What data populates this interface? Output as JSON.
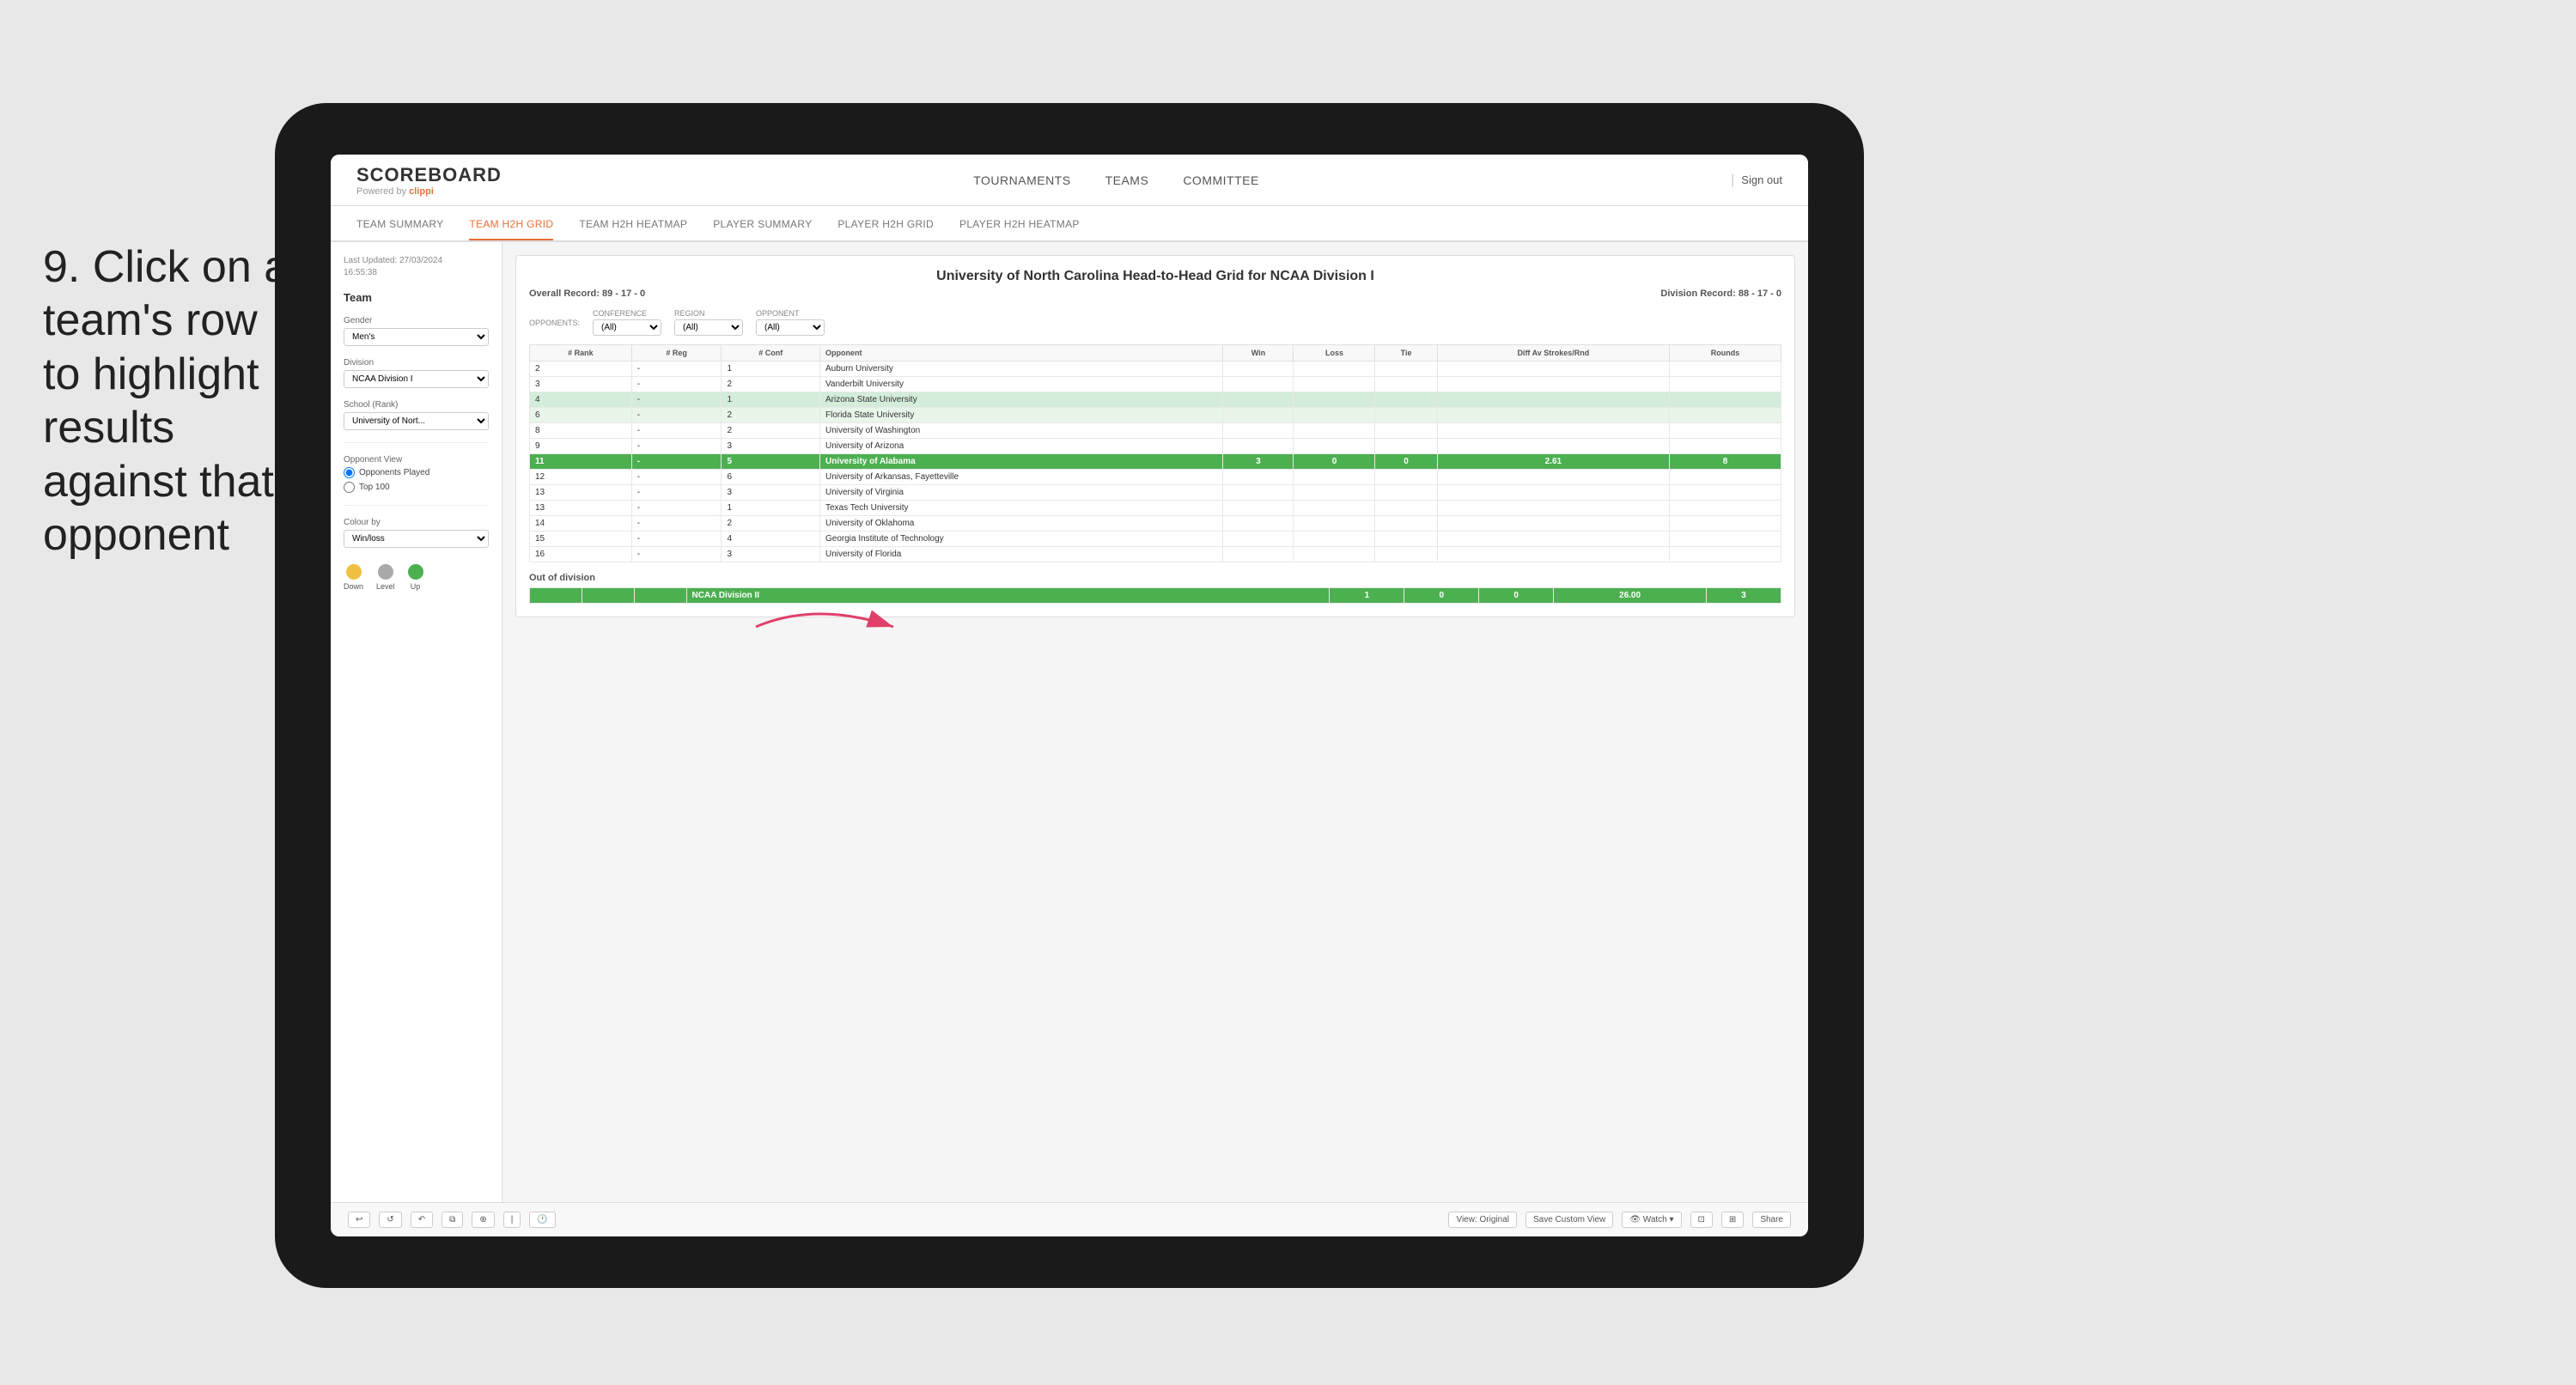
{
  "instruction": {
    "step": "9.",
    "text": "Click on a team's row to highlight results against that opponent"
  },
  "nav": {
    "logo": "SCOREBOARD",
    "powered_by": "Powered by",
    "brand": "clippi",
    "links": [
      "TOURNAMENTS",
      "TEAMS",
      "COMMITTEE"
    ],
    "sign_out": "Sign out"
  },
  "sub_tabs": [
    {
      "label": "TEAM SUMMARY",
      "active": false
    },
    {
      "label": "TEAM H2H GRID",
      "active": true
    },
    {
      "label": "TEAM H2H HEATMAP",
      "active": false
    },
    {
      "label": "PLAYER SUMMARY",
      "active": false
    },
    {
      "label": "PLAYER H2H GRID",
      "active": false
    },
    {
      "label": "PLAYER H2H HEATMAP",
      "active": false
    }
  ],
  "sidebar": {
    "meta_label": "Last Updated: 27/03/2024",
    "meta_time": "16:55:38",
    "team_label": "Team",
    "gender_label": "Gender",
    "gender_value": "Men's",
    "division_label": "Division",
    "division_value": "NCAA Division I",
    "school_label": "School (Rank)",
    "school_value": "University of Nort...",
    "opponent_view_label": "Opponent View",
    "radio_opponents": "Opponents Played",
    "radio_top100": "Top 100",
    "colour_by_label": "Colour by",
    "colour_by_value": "Win/loss",
    "legend_down": "Down",
    "legend_level": "Level",
    "legend_up": "Up"
  },
  "grid": {
    "title": "University of North Carolina Head-to-Head Grid for NCAA Division I",
    "overall_record_label": "Overall Record:",
    "overall_record": "89 - 17 - 0",
    "division_record_label": "Division Record:",
    "division_record": "88 - 17 - 0",
    "filters": {
      "conference_label": "Conference",
      "conference_value": "(All)",
      "region_label": "Region",
      "region_value": "(All)",
      "opponent_label": "Opponent",
      "opponent_value": "(All)",
      "opponents_label": "Opponents:"
    },
    "table_headers": [
      "# Rank",
      "# Reg",
      "# Conf",
      "Opponent",
      "Win",
      "Loss",
      "Tie",
      "Diff Av Strokes/Rnd",
      "Rounds"
    ],
    "rows": [
      {
        "rank": "2",
        "reg": "-",
        "conf": "1",
        "opponent": "Auburn University",
        "win": "",
        "loss": "",
        "tie": "",
        "diff": "",
        "rounds": "",
        "style": "normal"
      },
      {
        "rank": "3",
        "reg": "-",
        "conf": "2",
        "opponent": "Vanderbilt University",
        "win": "",
        "loss": "",
        "tie": "",
        "diff": "",
        "rounds": "",
        "style": "normal"
      },
      {
        "rank": "4",
        "reg": "-",
        "conf": "1",
        "opponent": "Arizona State University",
        "win": "",
        "loss": "",
        "tie": "",
        "diff": "",
        "rounds": "",
        "style": "light-green"
      },
      {
        "rank": "6",
        "reg": "-",
        "conf": "2",
        "opponent": "Florida State University",
        "win": "",
        "loss": "",
        "tie": "",
        "diff": "",
        "rounds": "",
        "style": "very-light-green"
      },
      {
        "rank": "8",
        "reg": "-",
        "conf": "2",
        "opponent": "University of Washington",
        "win": "",
        "loss": "",
        "tie": "",
        "diff": "",
        "rounds": "",
        "style": "normal"
      },
      {
        "rank": "9",
        "reg": "-",
        "conf": "3",
        "opponent": "University of Arizona",
        "win": "",
        "loss": "",
        "tie": "",
        "diff": "",
        "rounds": "",
        "style": "normal"
      },
      {
        "rank": "11",
        "reg": "-",
        "conf": "5",
        "opponent": "University of Alabama",
        "win": "3",
        "loss": "0",
        "tie": "0",
        "diff": "2.61",
        "rounds": "8",
        "style": "highlighted"
      },
      {
        "rank": "12",
        "reg": "-",
        "conf": "6",
        "opponent": "University of Arkansas, Fayetteville",
        "win": "",
        "loss": "",
        "tie": "",
        "diff": "",
        "rounds": "",
        "style": "normal"
      },
      {
        "rank": "13",
        "reg": "-",
        "conf": "3",
        "opponent": "University of Virginia",
        "win": "",
        "loss": "",
        "tie": "",
        "diff": "",
        "rounds": "",
        "style": "normal"
      },
      {
        "rank": "13",
        "reg": "-",
        "conf": "1",
        "opponent": "Texas Tech University",
        "win": "",
        "loss": "",
        "tie": "",
        "diff": "",
        "rounds": "",
        "style": "normal"
      },
      {
        "rank": "14",
        "reg": "-",
        "conf": "2",
        "opponent": "University of Oklahoma",
        "win": "",
        "loss": "",
        "tie": "",
        "diff": "",
        "rounds": "",
        "style": "normal"
      },
      {
        "rank": "15",
        "reg": "-",
        "conf": "4",
        "opponent": "Georgia Institute of Technology",
        "win": "",
        "loss": "",
        "tie": "",
        "diff": "",
        "rounds": "",
        "style": "normal"
      },
      {
        "rank": "16",
        "reg": "-",
        "conf": "3",
        "opponent": "University of Florida",
        "win": "",
        "loss": "",
        "tie": "",
        "diff": "",
        "rounds": "",
        "style": "normal"
      }
    ],
    "out_of_division": {
      "title": "Out of division",
      "row": {
        "label": "NCAA Division II",
        "win": "1",
        "loss": "0",
        "tie": "0",
        "diff": "26.00",
        "rounds": "3"
      }
    }
  },
  "toolbar": {
    "view_label": "View: Original",
    "save_label": "Save Custom View",
    "watch_label": "Watch",
    "share_label": "Share"
  },
  "colors": {
    "accent": "#e8703a",
    "active_tab": "#e8703a",
    "highlighted_row": "#4caf50",
    "light_green": "#d4edda",
    "very_light_green": "#e8f5e9",
    "legend_down": "#f0c040",
    "legend_level": "#aaa",
    "legend_up": "#4caf50"
  }
}
